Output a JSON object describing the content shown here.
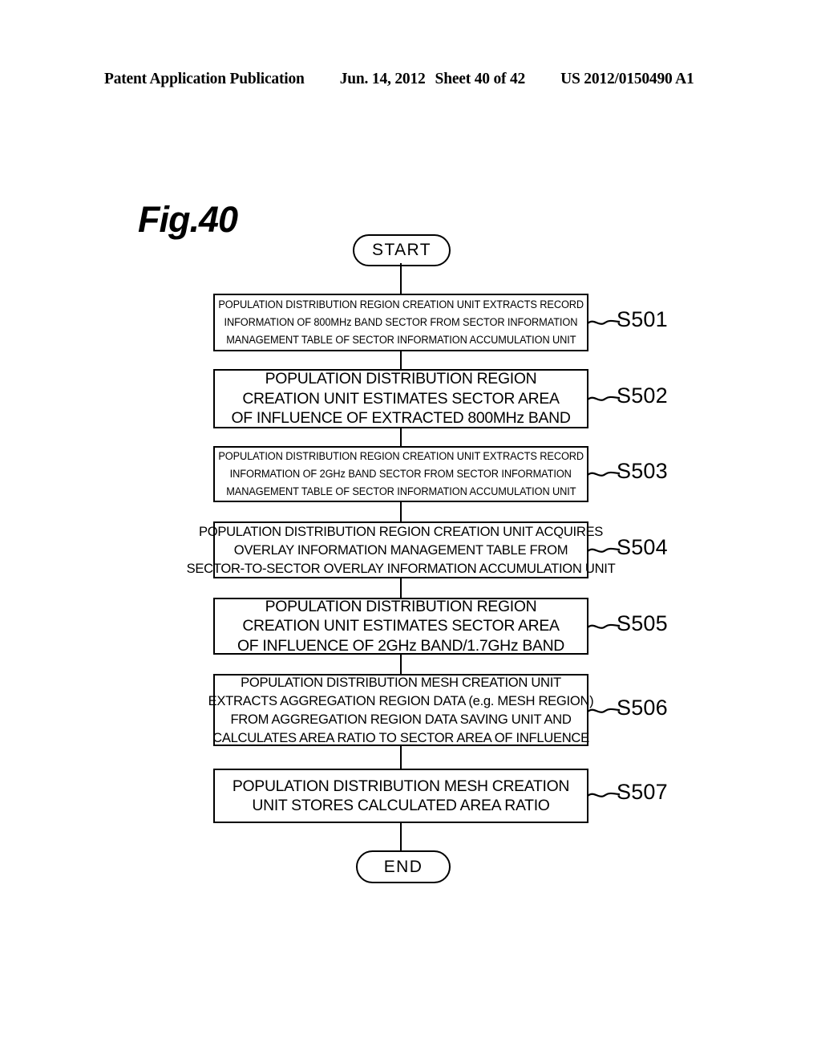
{
  "header": {
    "publication": "Patent Application Publication",
    "date": "Jun. 14, 2012",
    "sheet": "Sheet 40 of 42",
    "number": "US 2012/0150490 A1"
  },
  "figure": {
    "label": "Fig.40"
  },
  "flowchart": {
    "start_label": "START",
    "end_label": "END",
    "steps": [
      {
        "id": "S501",
        "style": "narrow",
        "lines": [
          "POPULATION DISTRIBUTION REGION CREATION UNIT EXTRACTS RECORD",
          "INFORMATION OF 800MHz BAND SECTOR FROM SECTOR INFORMATION",
          "MANAGEMENT TABLE OF SECTOR INFORMATION ACCUMULATION UNIT"
        ]
      },
      {
        "id": "S502",
        "style": "wide",
        "lines": [
          "POPULATION DISTRIBUTION REGION",
          "CREATION UNIT ESTIMATES SECTOR AREA",
          "OF INFLUENCE OF EXTRACTED 800MHz BAND"
        ]
      },
      {
        "id": "S503",
        "style": "narrow",
        "lines": [
          "POPULATION DISTRIBUTION REGION CREATION UNIT EXTRACTS RECORD",
          "INFORMATION OF 2GHz BAND SECTOR FROM SECTOR INFORMATION",
          "MANAGEMENT TABLE OF SECTOR INFORMATION ACCUMULATION UNIT"
        ]
      },
      {
        "id": "S504",
        "style": "midwide",
        "lines": [
          "POPULATION DISTRIBUTION REGION CREATION UNIT ACQUIRES",
          "OVERLAY INFORMATION MANAGEMENT TABLE FROM",
          "SECTOR-TO-SECTOR OVERLAY INFORMATION ACCUMULATION UNIT"
        ]
      },
      {
        "id": "S505",
        "style": "wide",
        "lines": [
          "POPULATION DISTRIBUTION REGION",
          "CREATION UNIT ESTIMATES SECTOR AREA",
          "OF INFLUENCE OF 2GHz BAND/1.7GHz BAND"
        ]
      },
      {
        "id": "S506",
        "style": "midwide",
        "lines": [
          "POPULATION DISTRIBUTION MESH CREATION UNIT",
          "EXTRACTS AGGREGATION REGION DATA (e.g. MESH REGION)",
          "FROM AGGREGATION REGION DATA SAVING UNIT AND",
          "CALCULATES AREA RATIO TO SECTOR AREA OF INFLUENCE"
        ]
      },
      {
        "id": "S507",
        "style": "wide",
        "lines": [
          "POPULATION DISTRIBUTION MESH CREATION",
          "UNIT STORES CALCULATED AREA RATIO"
        ]
      }
    ]
  },
  "colors": {
    "ink": "#000000",
    "paper": "#ffffff"
  }
}
